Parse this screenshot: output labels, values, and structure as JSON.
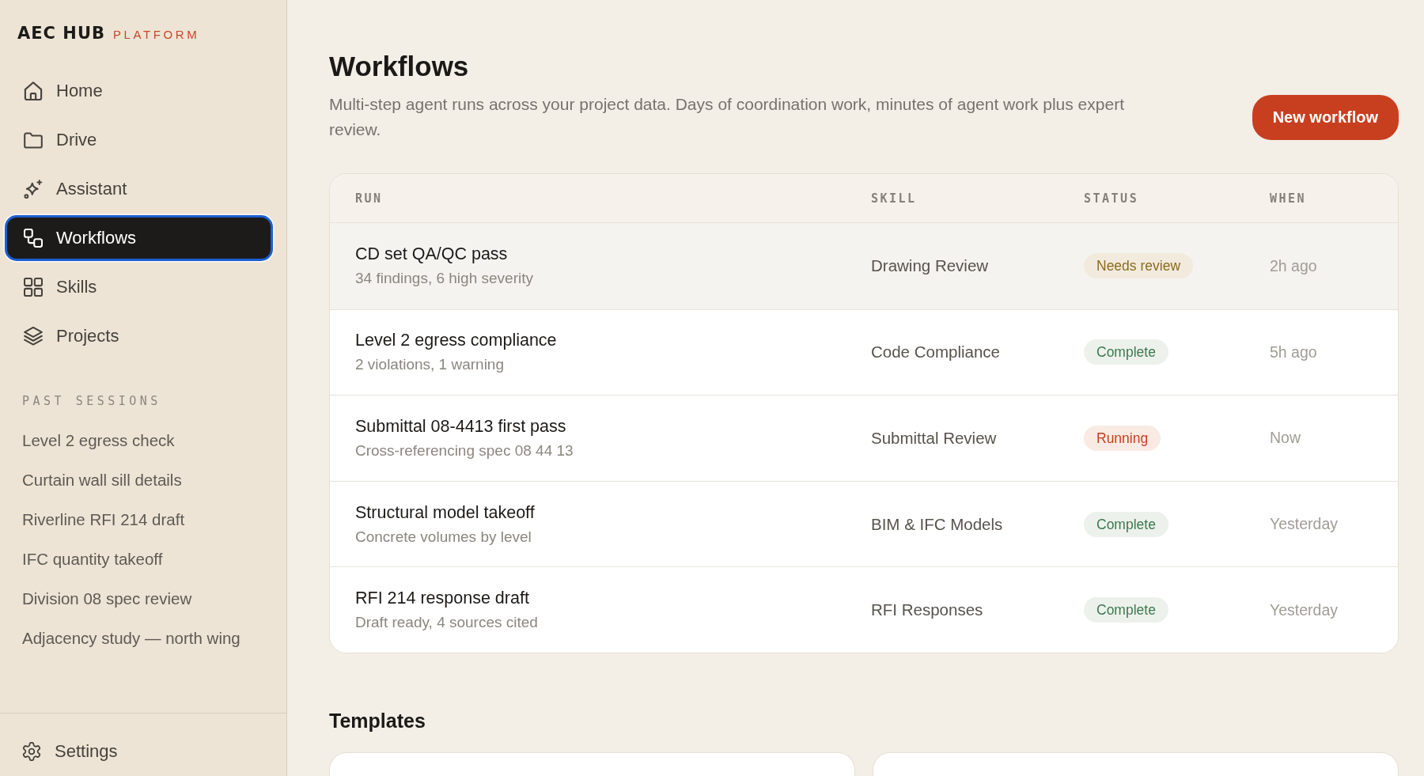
{
  "sidebar": {
    "logo": {
      "name": "AEC HUB",
      "tag": "PLATFORM"
    },
    "nav": [
      {
        "label": "Home",
        "selected": false
      },
      {
        "label": "Drive",
        "selected": false
      },
      {
        "label": "Assistant",
        "selected": false
      },
      {
        "label": "Workflows",
        "selected": true
      },
      {
        "label": "Skills",
        "selected": false
      },
      {
        "label": "Projects",
        "selected": false
      }
    ],
    "past_sessions": {
      "title": "PAST SESSIONS",
      "items": [
        {
          "label": "Level 2 egress check",
          "selected": false
        },
        {
          "label": "Curtain wall sill details",
          "selected": false
        },
        {
          "label": "Riverline RFI 214 draft",
          "selected": false
        },
        {
          "label": "IFC quantity takeoff",
          "selected": false
        },
        {
          "label": "Division 08 spec review",
          "selected": false
        },
        {
          "label": "Adjacency study — north wing",
          "selected": false
        }
      ]
    },
    "settings": {
      "label": "Settings"
    }
  },
  "main": {
    "title": "Workflows",
    "description": "Multi-step agent runs across your project data. Days of coordination work, minutes of agent work plus expert review.",
    "new_button": "New workflow",
    "table": {
      "columns": [
        "RUN",
        "SKILL",
        "STATUS",
        "WHEN"
      ],
      "rows": [
        {
          "title": "CD set QA/QC pass",
          "detail": "34 findings, 6 high severity",
          "skill": "Drawing Review",
          "status": {
            "label": "Needs review",
            "kind": "review"
          },
          "when": "2h ago",
          "highlighted": true
        },
        {
          "title": "Level 2 egress compliance",
          "detail": "2 violations, 1 warning",
          "skill": "Code Compliance",
          "status": {
            "label": "Complete",
            "kind": "complete"
          },
          "when": "5h ago",
          "highlighted": false
        },
        {
          "title": "Submittal 08-4413 first pass",
          "detail": "Cross-referencing spec 08 44 13",
          "skill": "Submittal Review",
          "status": {
            "label": "Running",
            "kind": "running"
          },
          "when": "Now",
          "highlighted": false
        },
        {
          "title": "Structural model takeoff",
          "detail": "Concrete volumes by level",
          "skill": "BIM & IFC Models",
          "status": {
            "label": "Complete",
            "kind": "complete"
          },
          "when": "Yesterday",
          "highlighted": false
        },
        {
          "title": "RFI 214 response draft",
          "detail": "Draft ready, 4 sources cited",
          "skill": "RFI Responses",
          "status": {
            "label": "Complete",
            "kind": "complete"
          },
          "when": "Yesterday",
          "highlighted": false
        }
      ]
    },
    "templates": {
      "title": "Templates"
    }
  }
}
